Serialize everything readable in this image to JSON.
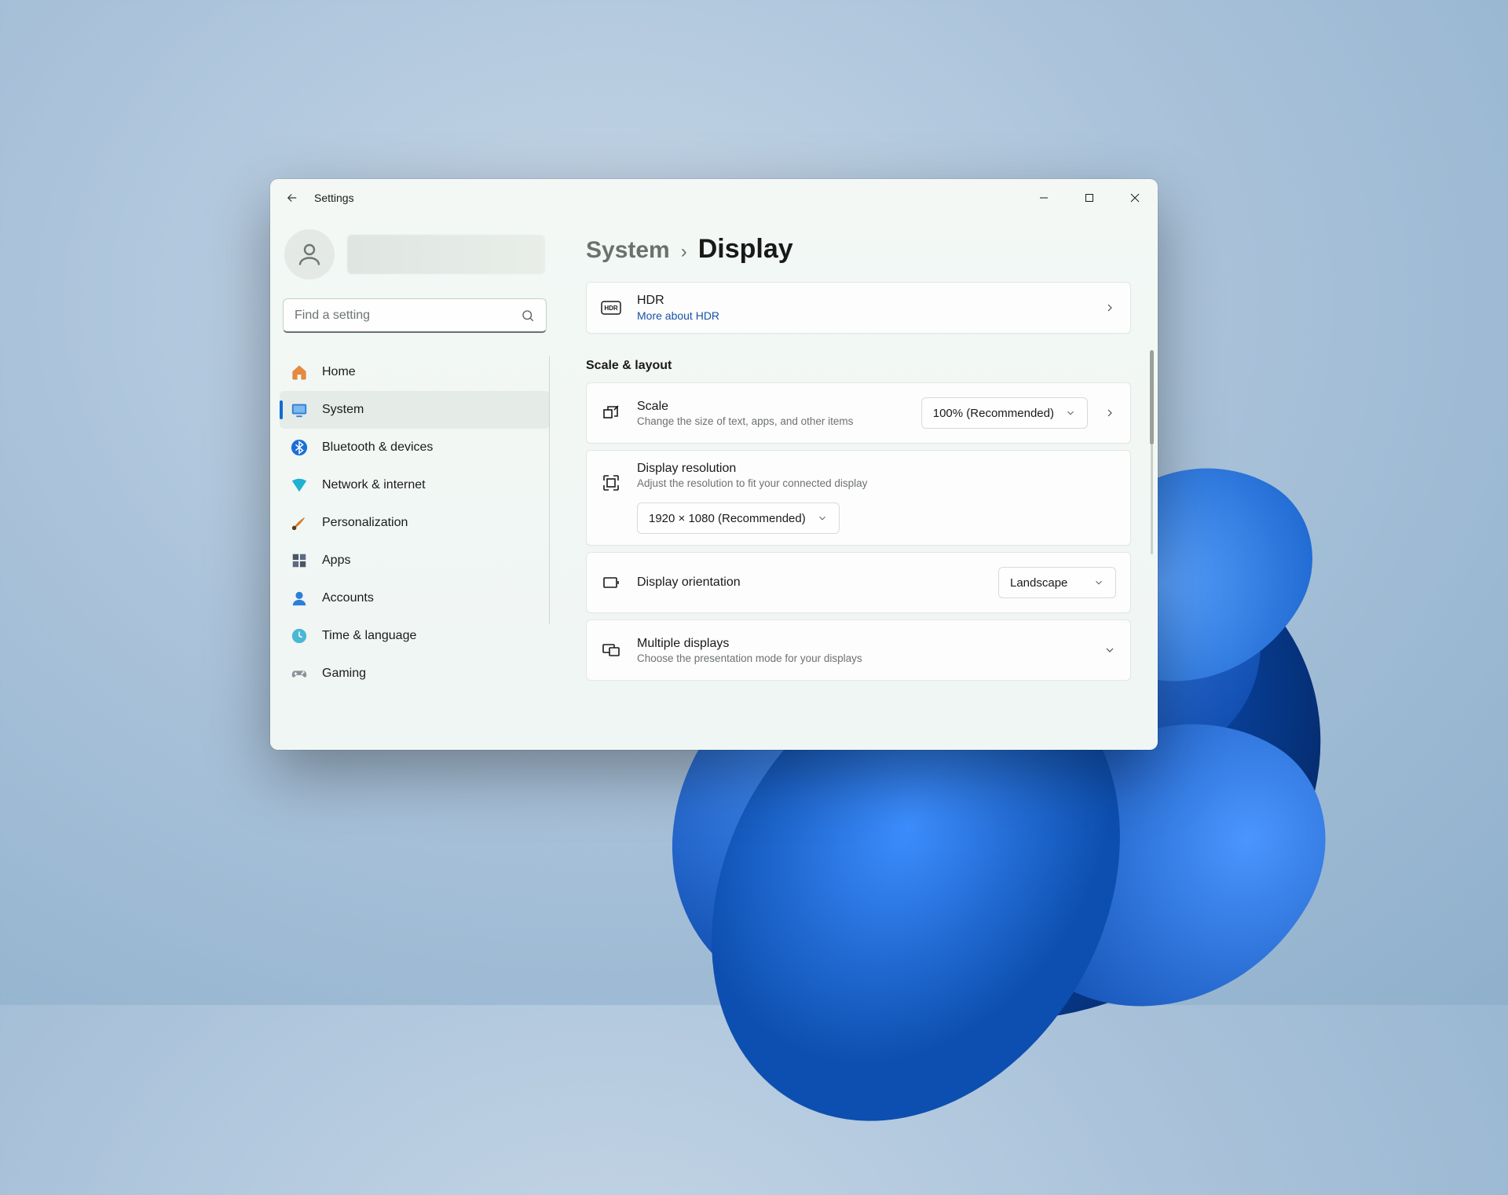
{
  "app_title": "Settings",
  "search": {
    "placeholder": "Find a setting"
  },
  "nav": {
    "items": [
      {
        "label": "Home"
      },
      {
        "label": "System"
      },
      {
        "label": "Bluetooth & devices"
      },
      {
        "label": "Network & internet"
      },
      {
        "label": "Personalization"
      },
      {
        "label": "Apps"
      },
      {
        "label": "Accounts"
      },
      {
        "label": "Time & language"
      },
      {
        "label": "Gaming"
      }
    ]
  },
  "breadcrumb": {
    "parent": "System",
    "current": "Display"
  },
  "hdr": {
    "title": "HDR",
    "link": "More about HDR"
  },
  "section": {
    "scale_layout": "Scale & layout"
  },
  "scale": {
    "title": "Scale",
    "sub": "Change the size of text, apps, and other items",
    "value": "100% (Recommended)"
  },
  "resolution": {
    "title": "Display resolution",
    "sub": "Adjust the resolution to fit your connected display",
    "value": "1920 × 1080 (Recommended)"
  },
  "orientation": {
    "title": "Display orientation",
    "value": "Landscape"
  },
  "multiple": {
    "title": "Multiple displays",
    "sub": "Choose the presentation mode for your displays"
  }
}
